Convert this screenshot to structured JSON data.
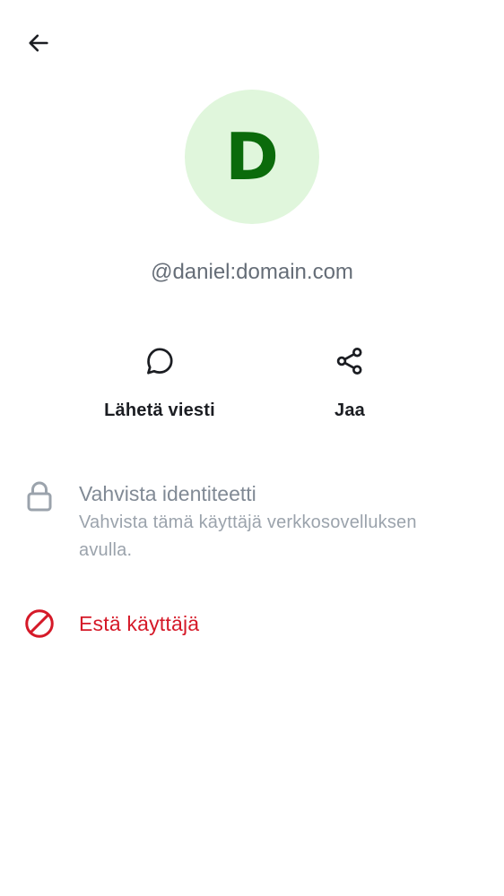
{
  "header": {
    "back_icon": "arrow-left-icon"
  },
  "profile": {
    "avatar_initial": "D",
    "avatar_bg": "#e0f6dc",
    "avatar_fg": "#0b6b0b",
    "user_id": "@daniel:domain.com"
  },
  "actions": [
    {
      "icon": "chat-bubble-icon",
      "label": "Lähetä viesti"
    },
    {
      "icon": "share-icon",
      "label": "Jaa"
    }
  ],
  "verify": {
    "icon": "lock-icon",
    "title": "Vahvista identiteetti",
    "subtitle": "Vahvista tämä käyttäjä verkkosovelluksen avulla."
  },
  "block": {
    "icon": "block-icon",
    "label": "Estä käyttäjä",
    "color": "#d51928"
  }
}
